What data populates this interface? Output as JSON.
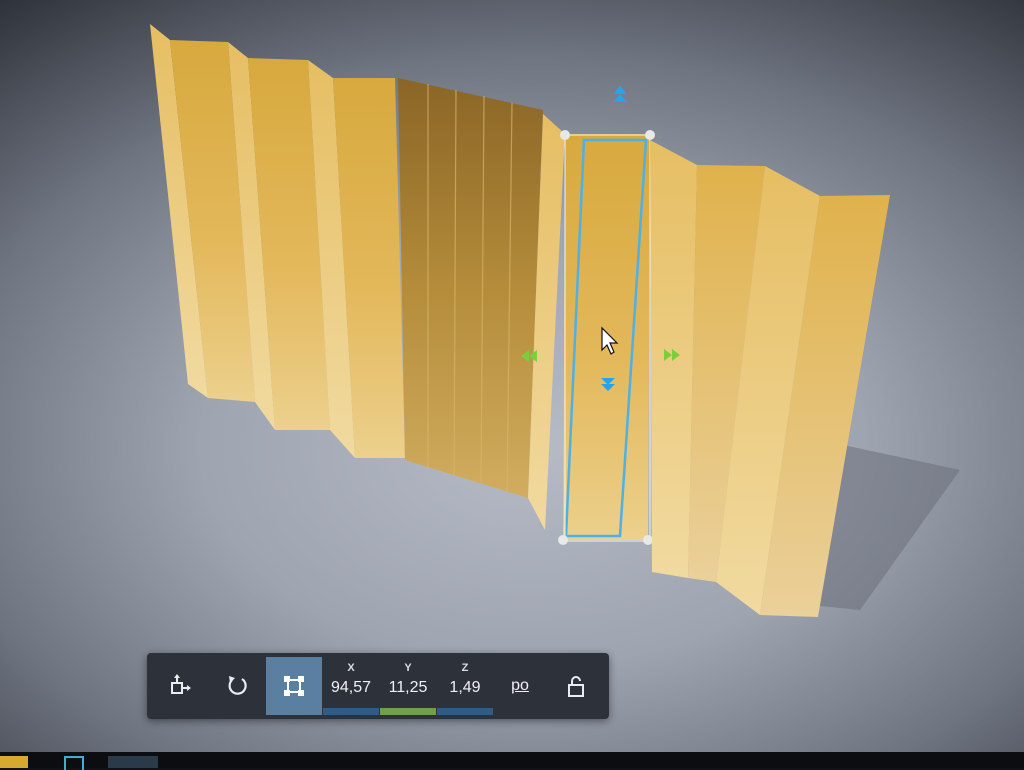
{
  "toolbar": {
    "coords": [
      {
        "axis": "X",
        "value": "94,57",
        "bar_color": "#2f5b85"
      },
      {
        "axis": "Y",
        "value": "11,25",
        "bar_color": "#6ea24a"
      },
      {
        "axis": "Z",
        "value": "1,49",
        "bar_color": "#2f5b85"
      }
    ],
    "unit_label": "po",
    "active_tool": "bounding-box-icon"
  },
  "colors": {
    "panel_gold": "#d9aa3f",
    "selection_blue": "#4fb0e6",
    "move_arrow_green": "#7ccf3c",
    "toolbar_bg": "#2c313a"
  },
  "icons": [
    "move-object-icon",
    "rotate-icon",
    "bounding-box-icon",
    "lock-open-icon",
    "cursor-icon"
  ]
}
